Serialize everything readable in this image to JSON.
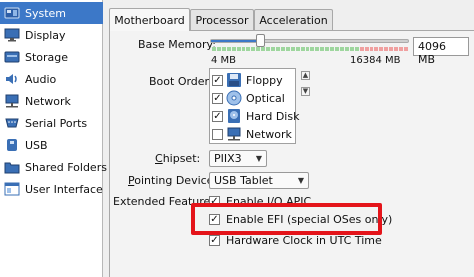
{
  "sidebar": {
    "items": [
      {
        "label": "System",
        "icon": "system-icon",
        "selected": true
      },
      {
        "label": "Display",
        "icon": "display-icon"
      },
      {
        "label": "Storage",
        "icon": "storage-icon"
      },
      {
        "label": "Audio",
        "icon": "audio-icon"
      },
      {
        "label": "Network",
        "icon": "network-icon"
      },
      {
        "label": "Serial Ports",
        "icon": "serial-ports-icon"
      },
      {
        "label": "USB",
        "icon": "usb-icon"
      },
      {
        "label": "Shared Folders",
        "icon": "shared-folders-icon"
      },
      {
        "label": "User Interface",
        "icon": "user-interface-icon"
      }
    ]
  },
  "tabs": [
    {
      "label": "Motherboard",
      "active": true
    },
    {
      "label": "Processor"
    },
    {
      "label": "Acceleration"
    }
  ],
  "motherboard": {
    "base_memory_label": "Base Memory:",
    "base_memory_value": "4096 MB",
    "base_memory_min": "4 MB",
    "base_memory_max": "16384 MB",
    "base_memory_fraction": 0.25,
    "boot_order_label": "Boot Order:",
    "boot_items": [
      {
        "label": "Floppy",
        "checked": true,
        "icon": "floppy-icon"
      },
      {
        "label": "Optical",
        "checked": true,
        "icon": "optical-disc-icon"
      },
      {
        "label": "Hard Disk",
        "checked": true,
        "icon": "hard-disk-icon"
      },
      {
        "label": "Network",
        "checked": false,
        "icon": "network-icon"
      }
    ],
    "chipset_label": "Chipset:",
    "chipset_value": "PIIX3",
    "pointing_device_label": "Pointing Device:",
    "pointing_device_value": "USB Tablet",
    "extended_features_label": "Extended Features:",
    "features": [
      {
        "label": "Enable I/O APIC",
        "checked": true
      },
      {
        "label": "Enable EFI (special OSes only)",
        "checked": true
      },
      {
        "label": "Hardware Clock in UTC Time",
        "checked": true
      }
    ]
  },
  "colors": {
    "selection": "#3c78c8",
    "highlight": "#e4141a",
    "slider_green": "#9ed69e",
    "slider_red": "#f0a0a0"
  }
}
